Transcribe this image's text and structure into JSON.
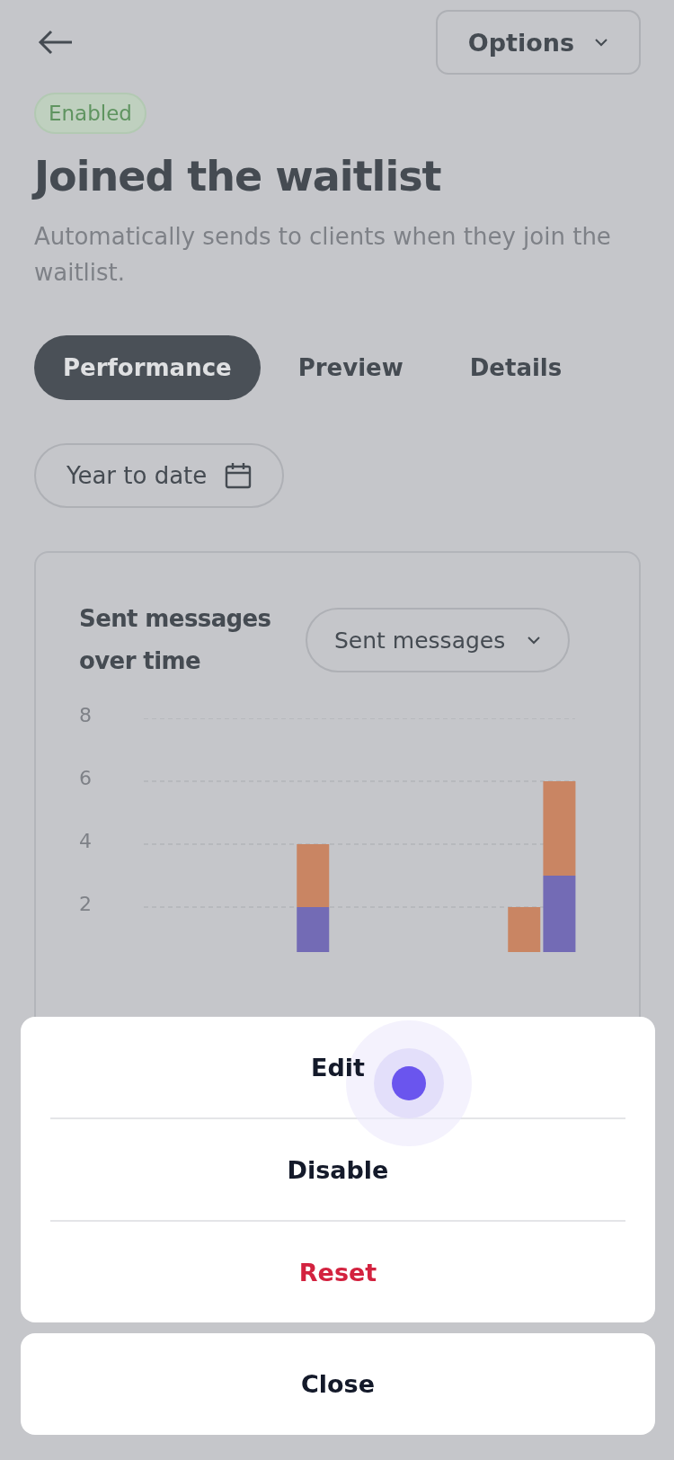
{
  "header": {
    "options_label": "Options"
  },
  "status_badge": "Enabled",
  "title": "Joined the waitlist",
  "description": "Automatically sends to clients when they join the waitlist.",
  "tabs": [
    {
      "label": "Performance",
      "selected": true
    },
    {
      "label": "Preview",
      "selected": false
    },
    {
      "label": "Details",
      "selected": false
    }
  ],
  "date_filter": "Year to date",
  "chart_card": {
    "title": "Sent messages over time",
    "metric_select": "Sent messages",
    "chart_data": {
      "type": "bar",
      "stacked": true,
      "grid": true,
      "yticks": [
        2,
        4,
        6,
        8
      ],
      "ylim": [
        0,
        8
      ],
      "series": [
        {
          "color": "#736bb5",
          "values": [
            0,
            0,
            0,
            0,
            2,
            0,
            0,
            0,
            0,
            0,
            0,
            3
          ]
        },
        {
          "color": "#c98563",
          "values": [
            0,
            0,
            0,
            0,
            2,
            0,
            0,
            0,
            0,
            0,
            2,
            3
          ]
        }
      ]
    }
  },
  "action_sheet": {
    "actions": [
      {
        "label": "Edit",
        "kind": "normal"
      },
      {
        "label": "Disable",
        "kind": "normal"
      },
      {
        "label": "Reset",
        "kind": "destructive"
      }
    ],
    "cancel": "Close"
  }
}
